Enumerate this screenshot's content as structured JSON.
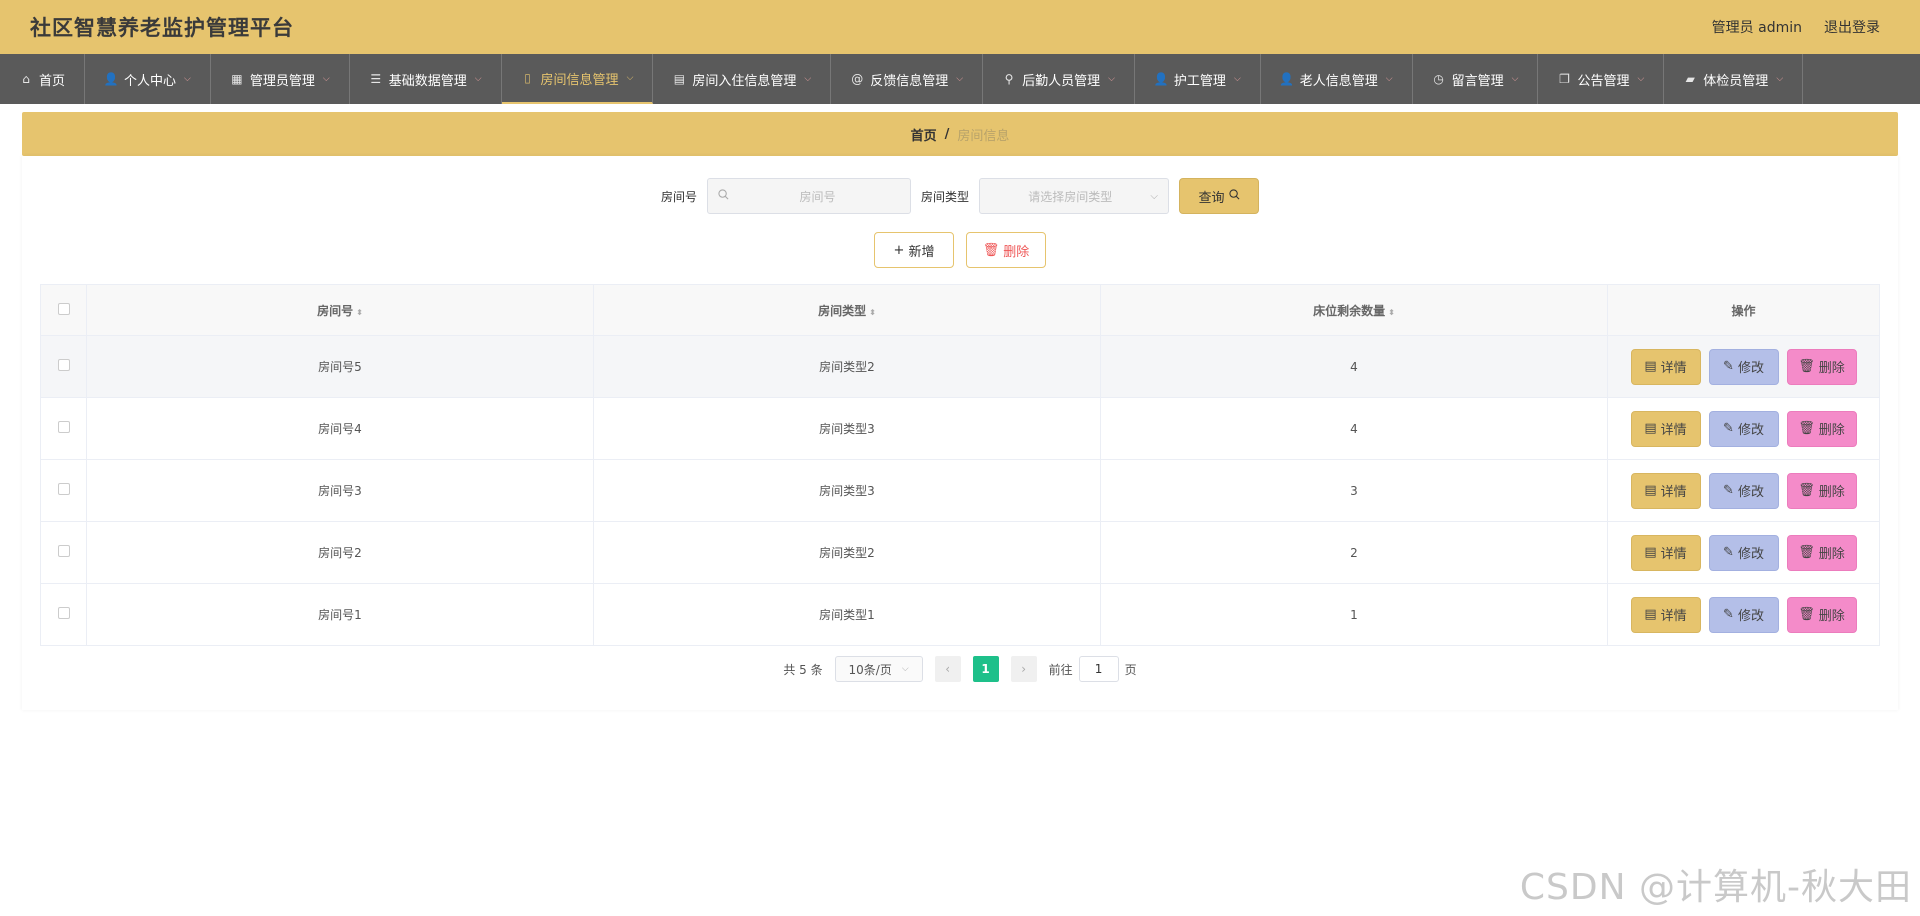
{
  "app": {
    "title": "社区智慧养老监护管理平台"
  },
  "header": {
    "user": "管理员 admin",
    "logout": "退出登录"
  },
  "nav": [
    {
      "label": "首页",
      "icon": "home-icon",
      "glyph": "⌂",
      "dropdown": false,
      "active": false
    },
    {
      "label": "个人中心",
      "icon": "user-icon",
      "glyph": "👤",
      "dropdown": true,
      "active": false
    },
    {
      "label": "管理员管理",
      "icon": "grid-icon",
      "glyph": "▦",
      "dropdown": true,
      "active": false
    },
    {
      "label": "基础数据管理",
      "icon": "sliders-icon",
      "glyph": "☰",
      "dropdown": true,
      "active": false
    },
    {
      "label": "房间信息管理",
      "icon": "phone-icon",
      "glyph": "▯",
      "dropdown": true,
      "active": true
    },
    {
      "label": "房间入住信息管理",
      "icon": "briefcase-icon",
      "glyph": "▤",
      "dropdown": true,
      "active": false
    },
    {
      "label": "反馈信息管理",
      "icon": "at-icon",
      "glyph": "@",
      "dropdown": true,
      "active": false
    },
    {
      "label": "后勤人员管理",
      "icon": "mic-icon",
      "glyph": "⚲",
      "dropdown": true,
      "active": false
    },
    {
      "label": "护工管理",
      "icon": "user-icon",
      "glyph": "👤",
      "dropdown": true,
      "active": false
    },
    {
      "label": "老人信息管理",
      "icon": "user-icon",
      "glyph": "👤",
      "dropdown": true,
      "active": false
    },
    {
      "label": "留言管理",
      "icon": "compass-icon",
      "glyph": "◷",
      "dropdown": true,
      "active": false
    },
    {
      "label": "公告管理",
      "icon": "copy-icon",
      "glyph": "❐",
      "dropdown": true,
      "active": false
    },
    {
      "label": "体检员管理",
      "icon": "camera-icon",
      "glyph": "▰",
      "dropdown": true,
      "active": false
    }
  ],
  "breadcrumb": {
    "home": "首页",
    "sep": "/",
    "current": "房间信息"
  },
  "search": {
    "room_label": "房间号",
    "room_placeholder": "房间号",
    "type_label": "房间类型",
    "type_placeholder": "请选择房间类型",
    "query_label": "查询"
  },
  "actions": {
    "add_label": "新增",
    "delete_label": "删除"
  },
  "table": {
    "headers": {
      "room": "房间号",
      "type": "房间类型",
      "beds": "床位剩余数量",
      "ops": "操作"
    },
    "rows": [
      {
        "room": "房间号5",
        "type": "房间类型2",
        "beds": "4"
      },
      {
        "room": "房间号4",
        "type": "房间类型3",
        "beds": "4"
      },
      {
        "room": "房间号3",
        "type": "房间类型3",
        "beds": "3"
      },
      {
        "room": "房间号2",
        "type": "房间类型2",
        "beds": "2"
      },
      {
        "room": "房间号1",
        "type": "房间类型1",
        "beds": "1"
      }
    ],
    "op_labels": {
      "detail": "详情",
      "edit": "修改",
      "remove": "删除"
    }
  },
  "pagination": {
    "total": "共 5 条",
    "page_size": "10条/页",
    "current_page": "1",
    "goto_prefix": "前往",
    "goto_value": "1",
    "goto_suffix": "页"
  },
  "watermark": "CSDN @计算机-秋大田",
  "colors": {
    "brand": "#e6c46e",
    "nav_bg": "#5a5a5a",
    "edit": "#b4bfe8",
    "remove": "#f48bc9",
    "page_active": "#1ec08a"
  }
}
